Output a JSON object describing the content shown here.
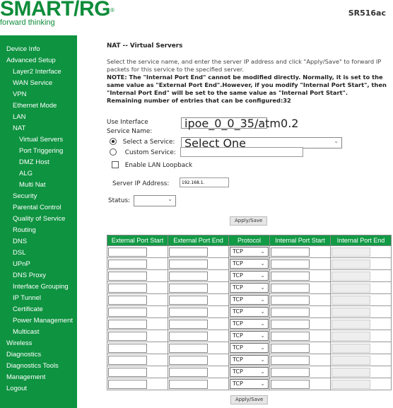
{
  "brand": {
    "logo_text": "SMART/RG",
    "registered": "®",
    "tagline": "forward thinking",
    "model": "SR516ac",
    "color": "#0e9340"
  },
  "sidebar": [
    {
      "label": "Device Info",
      "level": 0
    },
    {
      "label": "Advanced Setup",
      "level": 0
    },
    {
      "label": "Layer2 Interface",
      "level": 1
    },
    {
      "label": "WAN Service",
      "level": 1
    },
    {
      "label": "VPN",
      "level": 1
    },
    {
      "label": "Ethernet Mode",
      "level": 1
    },
    {
      "label": "LAN",
      "level": 1
    },
    {
      "label": "NAT",
      "level": 1
    },
    {
      "label": "Virtual Servers",
      "level": 2
    },
    {
      "label": "Port Triggering",
      "level": 2
    },
    {
      "label": "DMZ Host",
      "level": 2
    },
    {
      "label": "ALG",
      "level": 2
    },
    {
      "label": "Multi Nat",
      "level": 2
    },
    {
      "label": "Security",
      "level": 1
    },
    {
      "label": "Parental Control",
      "level": 1
    },
    {
      "label": "Quality of Service",
      "level": 1
    },
    {
      "label": "Routing",
      "level": 1
    },
    {
      "label": "DNS",
      "level": 1
    },
    {
      "label": "DSL",
      "level": 1
    },
    {
      "label": "UPnP",
      "level": 1
    },
    {
      "label": "DNS Proxy",
      "level": 1
    },
    {
      "label": "Interface Grouping",
      "level": 1
    },
    {
      "label": "IP Tunnel",
      "level": 1
    },
    {
      "label": "Certificate",
      "level": 1
    },
    {
      "label": "Power Management",
      "level": 1
    },
    {
      "label": "Multicast",
      "level": 1
    },
    {
      "label": "Wireless",
      "level": 0
    },
    {
      "label": "Diagnostics",
      "level": 0
    },
    {
      "label": "Diagnostics Tools",
      "level": 0
    },
    {
      "label": "Management",
      "level": 0
    },
    {
      "label": "Logout",
      "level": 0
    }
  ],
  "main": {
    "title": "NAT -- Virtual Servers",
    "description": "Select the service name, and enter the server IP address and click \"Apply/Save\" to forward IP packets for this service to the specified server.",
    "note": "NOTE: The \"Internal Port End\" cannot be modified directly. Normally, it is set to the same value as \"External Port End\".However, if you modify \"Internal Port Start\", then \"Internal Port End\" will be set to the same value as \"Internal Port Start\".",
    "remaining": "Remaining number of entries that can be configured:32",
    "use_interface_label": "Use Interface",
    "use_interface_value": "ipoe_0_0_35/atm0.2",
    "service_name_label": "Service Name:",
    "select_service_label": "Select a Service:",
    "select_service_value": "Select One",
    "custom_service_label": "Custom Service:",
    "custom_service_value": "",
    "lan_loopback_label": "Enable LAN Loopback",
    "server_ip_label": "Server IP Address:",
    "server_ip_value": "192.168.1.",
    "status_label": "Status:",
    "status_value": "",
    "apply_label": "Apply/Save"
  },
  "table": {
    "headers": [
      "External Port Start",
      "External Port End",
      "Protocol",
      "Internal Port Start",
      "Internal Port End"
    ],
    "protocol_default": "TCP",
    "row_count": 12
  }
}
